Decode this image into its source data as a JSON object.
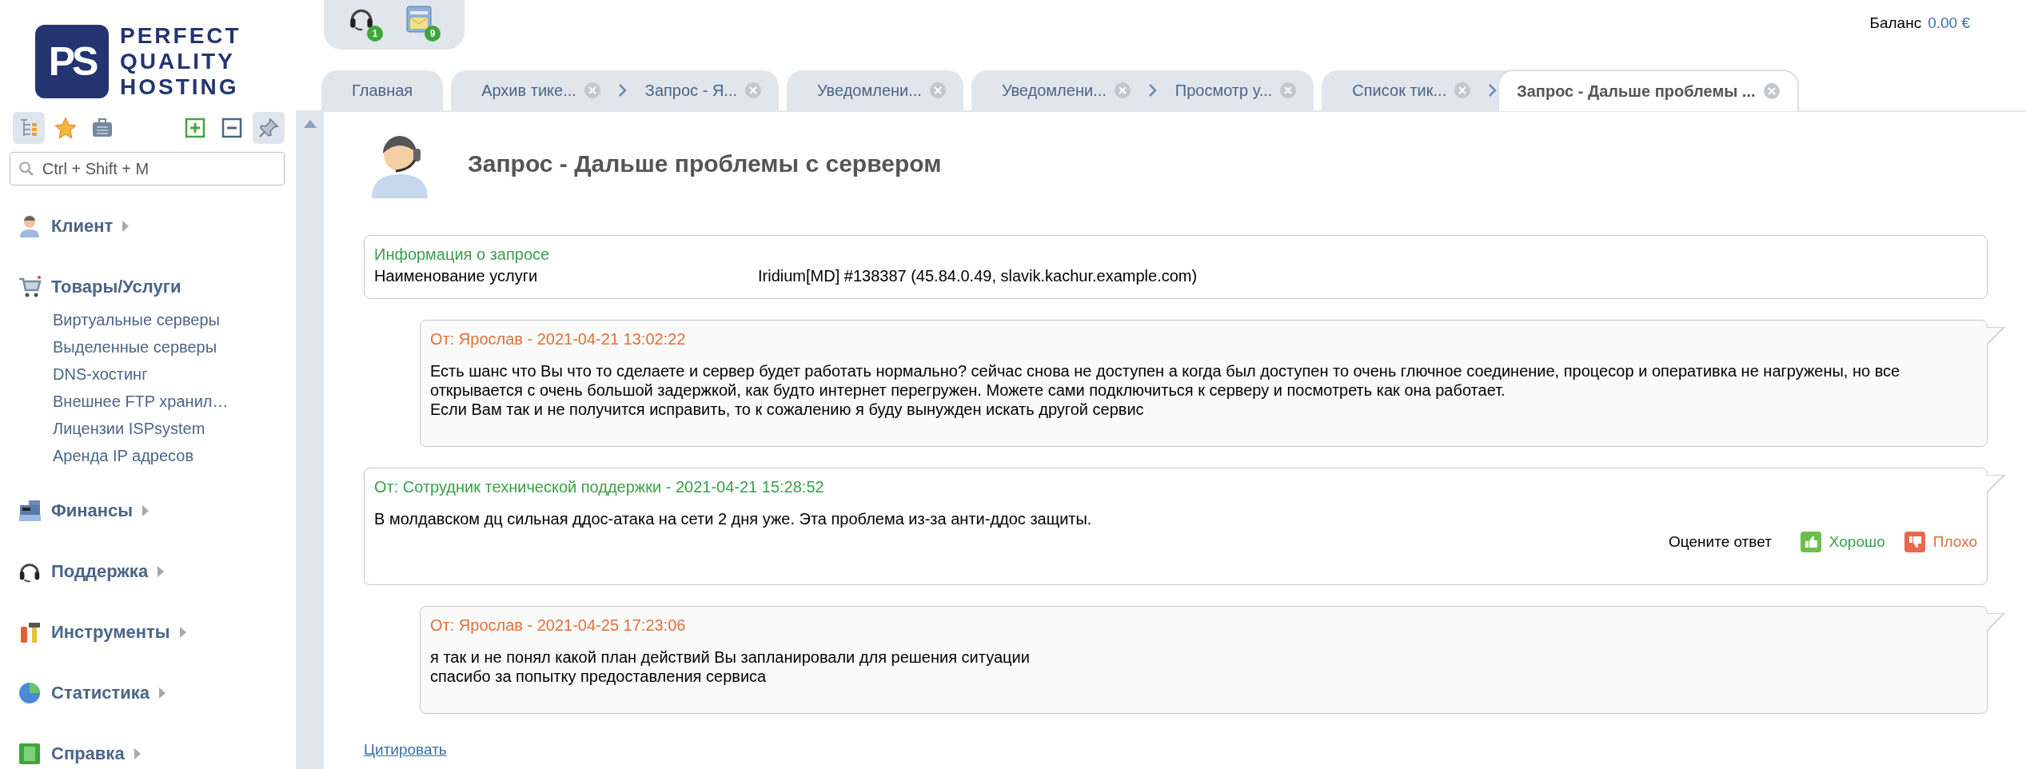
{
  "logo": {
    "mark": "PS",
    "lines": [
      "PERFECT",
      "QUALITY",
      "HOSTING"
    ]
  },
  "top_icons": [
    {
      "kind": "headset",
      "badge": "1"
    },
    {
      "kind": "mail",
      "badge": "9"
    }
  ],
  "balance": {
    "label": "Баланс",
    "value": "0.00 €"
  },
  "sidebar": {
    "toolbar": [
      {
        "kind": "tree",
        "selected": true
      },
      {
        "kind": "star",
        "selected": false
      },
      {
        "kind": "briefcase",
        "selected": false
      },
      {
        "kind": "plus",
        "selected": false
      },
      {
        "kind": "minus",
        "selected": false
      },
      {
        "kind": "pin",
        "selected": true
      }
    ],
    "search": {
      "placeholder": "Ctrl + Shift + M"
    },
    "items": [
      {
        "label": "Клиент",
        "kind": "client",
        "expanded": false
      },
      {
        "label": "Товары/Услуги",
        "kind": "cart",
        "expanded": true,
        "children": [
          {
            "label": "Виртуальные серверы"
          },
          {
            "label": "Выделенные серверы"
          },
          {
            "label": "DNS-хостинг"
          },
          {
            "label": "Внешнее FTP хранил…"
          },
          {
            "label": "Лицензии ISPsystem"
          },
          {
            "label": "Аренда IP адресов"
          }
        ]
      },
      {
        "label": "Финансы",
        "kind": "register",
        "expanded": false
      },
      {
        "label": "Поддержка",
        "kind": "headset",
        "expanded": false
      },
      {
        "label": "Инструменты",
        "kind": "tools",
        "expanded": false
      },
      {
        "label": "Статистика",
        "kind": "chart",
        "expanded": false
      },
      {
        "label": "Справка",
        "kind": "help",
        "expanded": false
      }
    ]
  },
  "tab_groups": [
    {
      "tabs": [
        {
          "label": "Главная",
          "closable": false,
          "selected": false
        }
      ]
    },
    {
      "tabs": [
        {
          "label": "Архив тике...",
          "closable": true,
          "selected": false
        },
        {
          "label": "Запрос - Я...",
          "closable": true,
          "selected": false
        }
      ]
    },
    {
      "tabs": [
        {
          "label": "Уведомлени...",
          "closable": true,
          "selected": false
        }
      ]
    },
    {
      "tabs": [
        {
          "label": "Уведомлени...",
          "closable": true,
          "selected": false
        },
        {
          "label": "Просмотр у...",
          "closable": true,
          "selected": false
        }
      ]
    },
    {
      "tabs": [
        {
          "label": "Список тик...",
          "closable": true,
          "selected": false
        },
        {
          "label": "Запрос - Дальше проблемы ...",
          "closable": true,
          "selected": true
        }
      ]
    }
  ],
  "page_title": "Запрос - Дальше проблемы с сервером",
  "info": {
    "title": "Информация о запросе",
    "rows": [
      {
        "label": "Наименование услуги",
        "value": "Iridium[MD] #138387 (45.84.0.49, slavik.kachur.example.com)"
      }
    ]
  },
  "messages": [
    {
      "kind": "client",
      "header": "От: Ярослав - 2021-04-21 13:02:22",
      "paragraphs": [
        "Есть шанс что Вы что то сделаете и сервер будет работать нормально? сейчас снова не доступен а когда был доступен то очень глючное соединение, процесор и оперативка не нагружены, но все открывается с очень большой задержкой, как будто интернет перегружен. Можете сами подключиться к серверу и посмотреть как она работает.",
        "Если Вам так и не получится исправить, то к сожалению я буду вынужден искать другой сервис"
      ]
    },
    {
      "kind": "staff",
      "header": "От: Сотрудник технической поддержки - 2021-04-21 15:28:52",
      "paragraphs": [
        "В молдавском дц сильная ддос-атака на сети 2 дня уже. Эта проблема из-за анти-ддос защиты."
      ],
      "rating": {
        "label": "Оцените ответ",
        "good": "Хорошо",
        "bad": "Плохо"
      }
    },
    {
      "kind": "client",
      "header": "От: Ярослав - 2021-04-25 17:23:06",
      "paragraphs": [
        "я так и не понял какой план действий Вы запланировали для решения ситуации",
        "спасибо за попытку предоставления сервиса"
      ]
    }
  ],
  "quote_link": "Цитировать"
}
